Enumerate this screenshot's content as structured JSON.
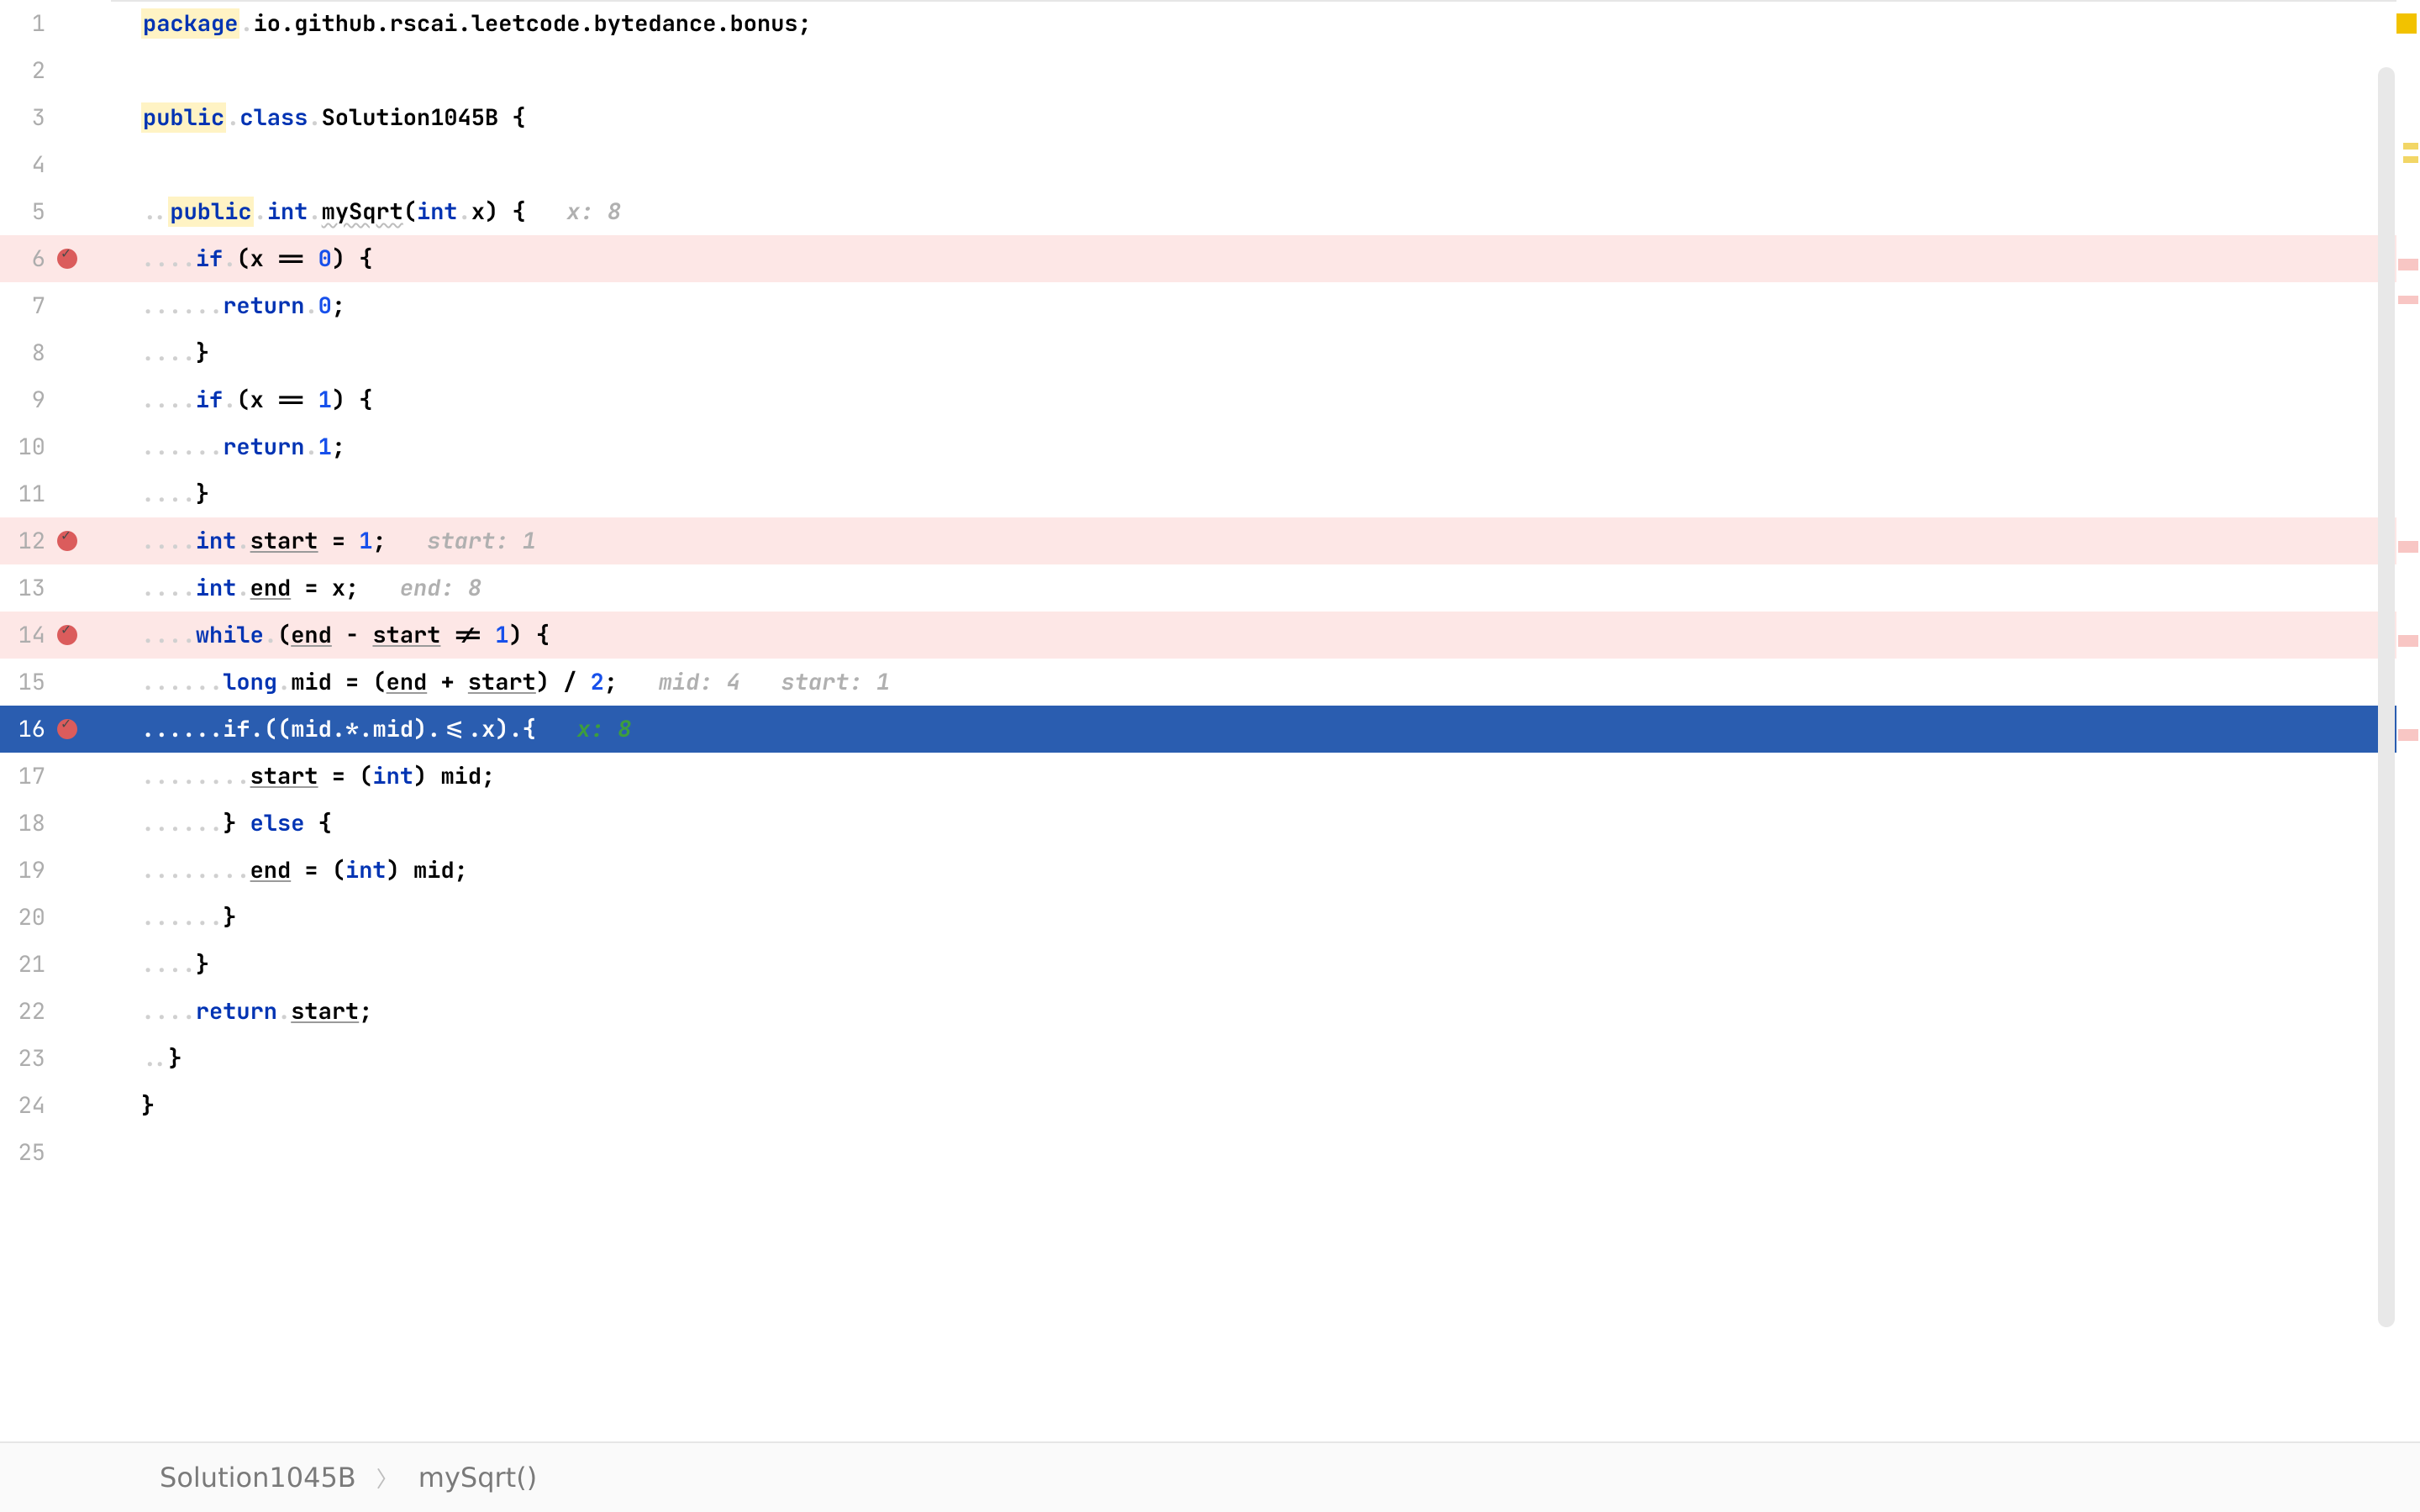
{
  "file": {
    "package_kw": "package",
    "package_name": "io.github.rscai.leetcode.bytedance.bonus",
    "class_decl": {
      "public": "public",
      "class": "class",
      "name": "Solution1045B"
    },
    "method": {
      "public": "public",
      "ret": "int",
      "name": "mySqrt",
      "param_type": "int",
      "param_name": "x",
      "hint": "x: 8"
    },
    "l6": {
      "if": "if",
      "expr_a": "x",
      "op": "==",
      "expr_b": "0"
    },
    "l7": {
      "return": "return",
      "val": "0"
    },
    "l9": {
      "if": "if",
      "expr_a": "x",
      "op": "==",
      "expr_b": "1"
    },
    "l10": {
      "return": "return",
      "val": "1"
    },
    "l12": {
      "type": "int",
      "name": "start",
      "val": "1",
      "hint": "start: 1"
    },
    "l13": {
      "type": "int",
      "name": "end",
      "rhs": "x",
      "hint": "end: 8"
    },
    "l14": {
      "while": "while",
      "a": "end",
      "b": "start",
      "op1": "-",
      "op2": "!=",
      "rhs": "1"
    },
    "l15": {
      "type": "long",
      "name": "mid",
      "a": "end",
      "b": "start",
      "div": "2",
      "hint1": "mid: 4",
      "hint2": "start: 1"
    },
    "l16": {
      "if": "if",
      "a": "mid",
      "b": "mid",
      "op1": "*",
      "op2": "<=",
      "rhs": "x",
      "hint": "x: 8"
    },
    "l17": {
      "lhs": "start",
      "cast": "int",
      "rhs": "mid"
    },
    "l18": {
      "else": "else"
    },
    "l19": {
      "lhs": "end",
      "cast": "int",
      "rhs": "mid"
    },
    "l22": {
      "return": "return",
      "val": "start"
    }
  },
  "line_numbers": [
    "1",
    "2",
    "3",
    "4",
    "5",
    "6",
    "7",
    "8",
    "9",
    "10",
    "11",
    "12",
    "13",
    "14",
    "15",
    "16",
    "17",
    "18",
    "19",
    "20",
    "21",
    "22",
    "23",
    "24",
    "25"
  ],
  "breakpoints": [
    6,
    12,
    14,
    16
  ],
  "execution_line": 16,
  "breadcrumbs": {
    "a": "Solution1045B",
    "b": "mySqrt()"
  },
  "markers": {
    "warning_top": true,
    "yellow_markers": [
      100,
      168
    ],
    "pink_markers": [
      320,
      340,
      666,
      780,
      900
    ]
  }
}
